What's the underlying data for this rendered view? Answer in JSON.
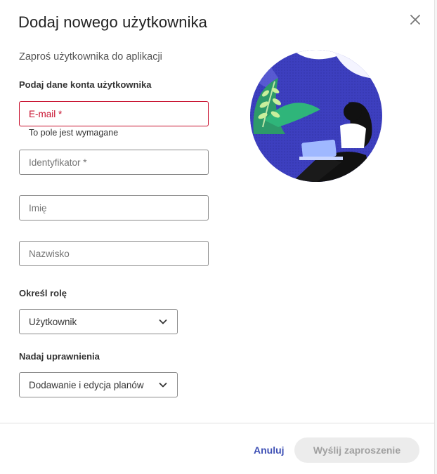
{
  "dialog": {
    "title": "Dodaj nowego użytkownika",
    "subtitle": "Zaproś użytkownika do aplikacji"
  },
  "account_section": {
    "heading": "Podaj dane konta użytkownika",
    "email": {
      "placeholder": "E-mail *",
      "error": "To pole jest wymagane"
    },
    "identifier": {
      "placeholder": "Identyfikator *"
    },
    "first_name": {
      "placeholder": "Imię"
    },
    "last_name": {
      "placeholder": "Nazwisko"
    }
  },
  "role_section": {
    "heading": "Określ rolę",
    "selected": "Użytkownik"
  },
  "permissions_section": {
    "heading": "Nadaj uprawnienia",
    "selected": "Dodawanie i edycja planów"
  },
  "footer": {
    "cancel_label": "Anuluj",
    "send_label": "Wyślij zaproszenie"
  },
  "colors": {
    "accent": "#3f51b5",
    "error": "#c8102e",
    "illustration_bg": "#3d3fbf"
  },
  "icons": {
    "close": "close-icon",
    "dropdown": "chevron-down-icon"
  }
}
